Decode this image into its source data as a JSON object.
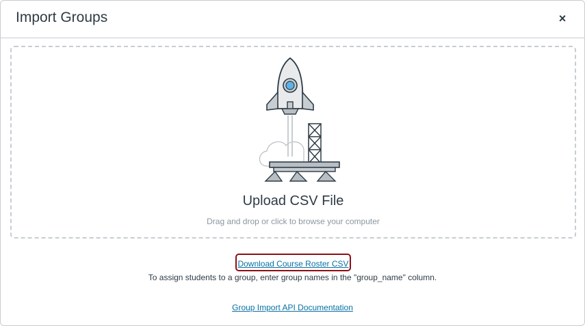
{
  "header": {
    "title": "Import Groups",
    "close_label": "×"
  },
  "dropzone": {
    "illustration": "rocket-launch-icon",
    "title": "Upload CSV File",
    "subtitle": "Drag and drop or click to browse your computer"
  },
  "footer": {
    "roster_link": "Download Course Roster CSV",
    "assign_text": "To assign students to a group, enter group names in the \"group_name\" column.",
    "api_link": "Group Import API Documentation"
  },
  "colors": {
    "link": "#0770a3",
    "highlight_border": "#8c0d15",
    "text": "#2d3b45",
    "muted": "#8b969e",
    "rocket_window": "#5bb3e8"
  }
}
